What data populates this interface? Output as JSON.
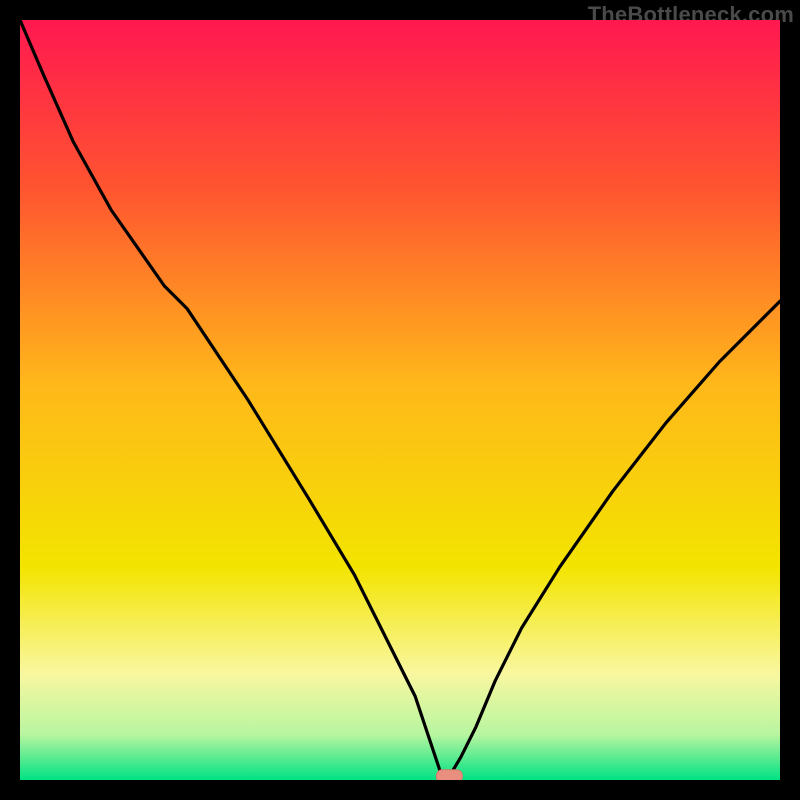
{
  "watermark": "TheBottleneck.com",
  "colors": {
    "black": "#000000",
    "line": "#000000",
    "marker_fill": "#e88f80",
    "marker_stroke": "#d97a6a",
    "grad_top": "#ff1850",
    "grad_q1": "#ff5430",
    "grad_mid": "#ffb81a",
    "grad_q3": "#f3e400",
    "grad_q4": "#f9f7a0",
    "grad_bottom1": "#b8f5a0",
    "grad_bottom2": "#00e283"
  },
  "chart_data": {
    "type": "line",
    "title": "",
    "xlabel": "",
    "ylabel": "",
    "x": [
      0.0,
      0.03,
      0.07,
      0.12,
      0.19,
      0.22,
      0.3,
      0.38,
      0.44,
      0.48,
      0.52,
      0.54,
      0.555,
      0.56,
      0.565,
      0.58,
      0.6,
      0.625,
      0.66,
      0.71,
      0.78,
      0.85,
      0.92,
      1.0
    ],
    "values": [
      1.0,
      0.93,
      0.84,
      0.75,
      0.65,
      0.62,
      0.5,
      0.37,
      0.27,
      0.19,
      0.11,
      0.05,
      0.005,
      0.005,
      0.005,
      0.03,
      0.07,
      0.13,
      0.2,
      0.28,
      0.38,
      0.47,
      0.55,
      0.63
    ],
    "xlim": [
      0,
      1
    ],
    "ylim": [
      0,
      1
    ],
    "marker": {
      "x": 0.565,
      "y": 0.005
    },
    "note": "x and y are normalized to plot area [0,1]; no numeric axes shown in original."
  }
}
